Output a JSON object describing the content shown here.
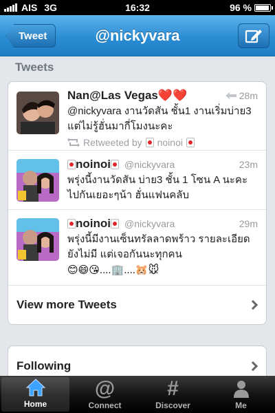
{
  "status_bar": {
    "carrier": "AIS",
    "network": "3G",
    "time": "16:32",
    "battery": "96 %",
    "battery_level": 0.96
  },
  "nav": {
    "back_label": "Tweet",
    "title": "@nickyvara"
  },
  "section": {
    "title": "Tweets"
  },
  "tweets": [
    {
      "author": "Nan@Las Vegas",
      "author_suffix": "❤️❤️",
      "handle": "",
      "time": "28m",
      "text": "@nickyvara งานวัดสัน ชั้น1 งานเริ่มบ่าย3 แต่ไม่รู้ฮั่นมากี่โมงนะคะ",
      "retweet_by_label": "Retweeted by",
      "retweet_by_name": "noinoi"
    },
    {
      "author": "noinoi",
      "handle": "@nickyvara",
      "time": "23m",
      "text": "พรุ่งนี้งานวัดสัน บ่าย3 ชั้น 1 โซน A นะคะ ไปกันเยอะๆน้า ฮั่นแฟนคลับ"
    },
    {
      "author": "noinoi",
      "handle": "@nickyvara",
      "time": "29m",
      "text": "พรุ่งนี้มีงานเซ็นทรัลลาดพร้าว รายละเอียดยังไม่มี แต่เจอกันนะทุกคน",
      "emoji_line": "😊😄😘....🏢....🐹🐭"
    }
  ],
  "view_more_label": "View more Tweets",
  "following_label": "Following",
  "tabs": [
    {
      "label": "Home",
      "icon": "home-icon",
      "active": true
    },
    {
      "label": "Connect",
      "icon": "at-icon",
      "active": false
    },
    {
      "label": "Discover",
      "icon": "hash-icon",
      "active": false
    },
    {
      "label": "Me",
      "icon": "person-icon",
      "active": false
    }
  ],
  "colors": {
    "nav_blue": "#2b8dd4",
    "active_tab_icon": "#3ea2ff",
    "heart": "#e0262c"
  }
}
